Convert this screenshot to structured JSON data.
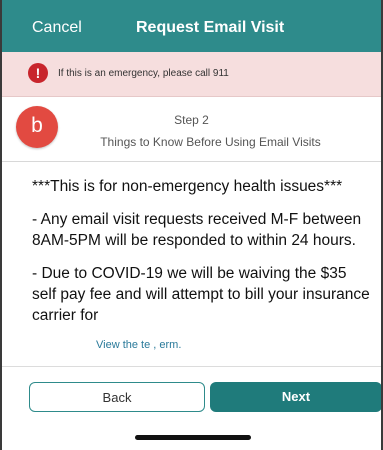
{
  "header": {
    "cancel_label": "Cancel",
    "title": "Request Email Visit"
  },
  "alert": {
    "icon": "exclamation-circle-icon",
    "text": "If this is an emergency, please call 911",
    "color": "#c8252c"
  },
  "badge": {
    "label": "b"
  },
  "steps": {
    "number": "Step 2",
    "name": "Things to Know Before Using Email Visits"
  },
  "content": {
    "paragraphs": [
      "***This is for non-emergency health issues***",
      "- Any email visit requests received M-F between 8AM-5PM will be responded to within 24 hours.",
      "- Due to COVID-19 we will be waiving the $35 self pay fee and will attempt to bill your insurance carrier for"
    ]
  },
  "link": {
    "text": "View the te   ,   erm."
  },
  "footer": {
    "back_label": "Back",
    "next_label": "Next"
  },
  "colors": {
    "header": "#2e8b8b",
    "next_button": "#1f7b7b",
    "alert_bg": "#f6dede",
    "badge": "#e24a41"
  }
}
